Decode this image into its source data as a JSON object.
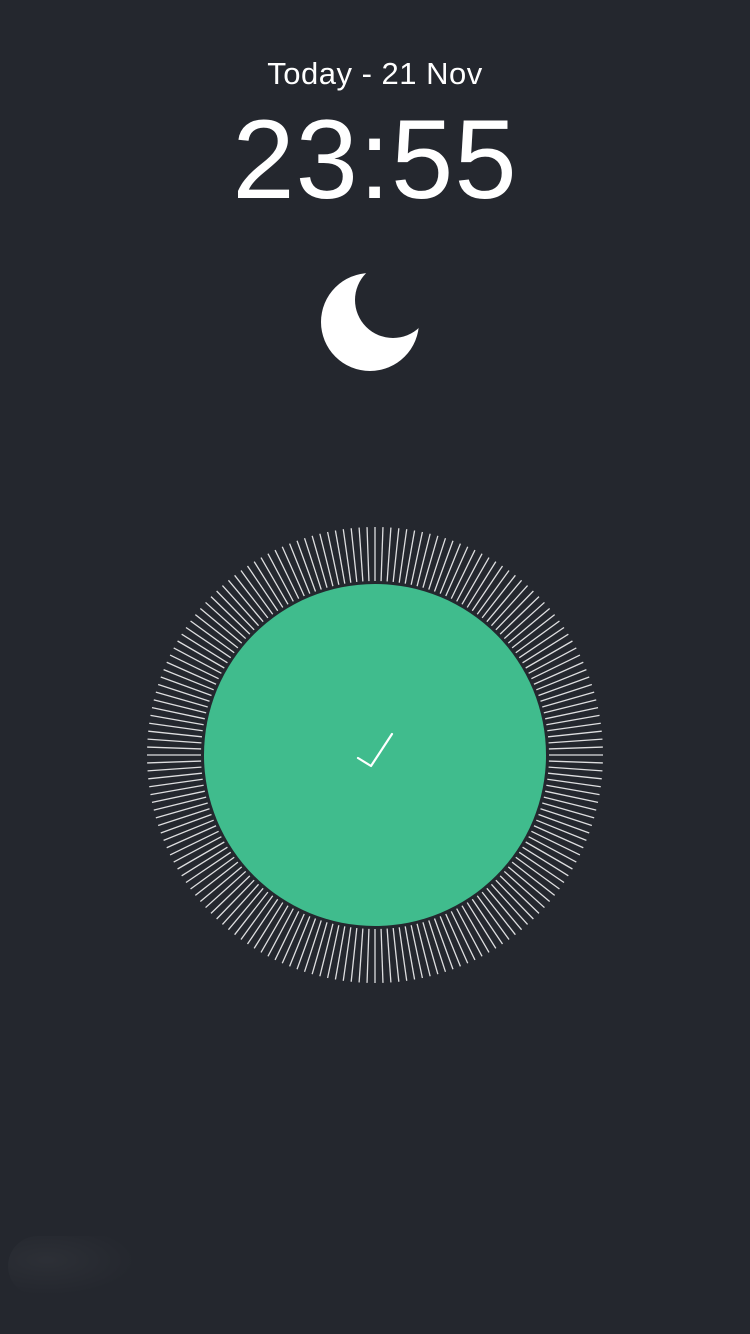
{
  "header": {
    "date_label": "Today - 21 Nov",
    "time": "23:55"
  },
  "status_icon": "moon-icon",
  "confirm": {
    "icon": "checkmark-icon",
    "color": "#40bc8d"
  },
  "dial": {
    "icon": "tick-ring",
    "tick_color": "#ffffff"
  },
  "colors": {
    "background": "#24272e",
    "accent": "#40bc8d",
    "text": "#ffffff"
  }
}
